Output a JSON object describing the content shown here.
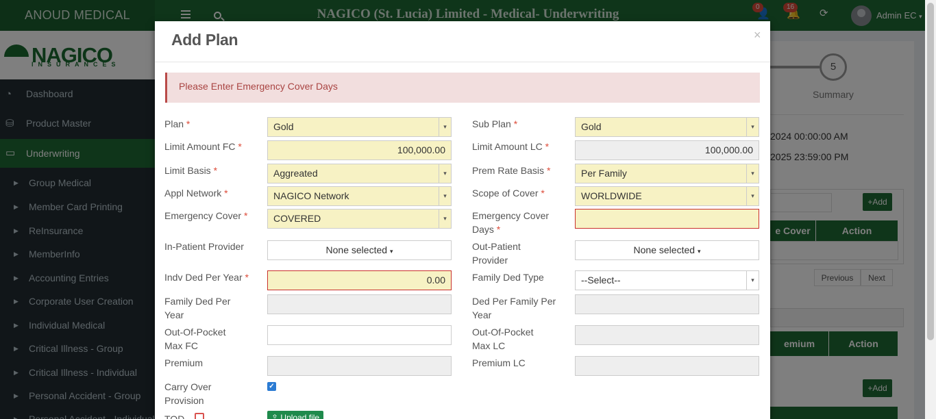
{
  "topbar": {
    "brand": "ANOUD MEDICAL",
    "title": "NAGICO (St. Lucia) Limited - Medical- Underwriting",
    "user_badge": "0",
    "notif_badge": "16",
    "user_name": "Admin EC"
  },
  "logo": {
    "text": "NAGICO",
    "sub": "INSURANCES"
  },
  "sidebar": {
    "items": [
      {
        "label": "Dashboard"
      },
      {
        "label": "Product Master"
      },
      {
        "label": "Underwriting"
      }
    ],
    "subitems": [
      "Group Medical",
      "Member Card Printing",
      "ReInsurance",
      "MemberInfo",
      "Accounting Entries",
      "Corporate User Creation",
      "Individual Medical",
      "Critical Illness - Group",
      "Critical Illness - Individual",
      "Personal Accident - Group",
      "Personal Accident - Individual"
    ]
  },
  "background": {
    "step_number": "5",
    "step_label": "Summary",
    "date1": "2024 00:00:00 AM",
    "date2": "2025 23:59:00 PM",
    "add_label": "Add",
    "col_cover": "e Cover",
    "col_action": "Action",
    "prev_label": "Previous",
    "next_label": "Next",
    "col_premium": "emium",
    "col_action2": "Action",
    "add_label2": "Add"
  },
  "modal": {
    "title": "Add Plan",
    "close": "×",
    "alert": "Please Enter Emergency Cover Days",
    "fields": {
      "plan": {
        "label": "Plan",
        "value": "Gold"
      },
      "sub_plan": {
        "label": "Sub Plan",
        "value": "Gold"
      },
      "limit_fc": {
        "label": "Limit Amount FC",
        "value": "100,000.00"
      },
      "limit_lc": {
        "label": "Limit Amount LC",
        "value": "100,000.00"
      },
      "limit_basis": {
        "label": "Limit Basis",
        "value": "Aggreated"
      },
      "prem_rate_basis": {
        "label": "Prem Rate Basis",
        "value": "Per Family"
      },
      "appl_network": {
        "label": "Appl Network",
        "value": "NAGICO Network"
      },
      "scope_cover": {
        "label": "Scope of Cover",
        "value": "WORLDWIDE"
      },
      "emergency_cover": {
        "label": "Emergency Cover",
        "value": "COVERED"
      },
      "emergency_days": {
        "label1": "Emergency Cover",
        "label2": "Days",
        "value": ""
      },
      "inpatient": {
        "label": "In-Patient Provider",
        "value": "None selected"
      },
      "outpatient": {
        "label1": "Out-Patient",
        "label2": "Provider",
        "value": "None selected"
      },
      "indv_ded": {
        "label": "Indv Ded Per Year",
        "value": "0.00"
      },
      "family_ded_type": {
        "label": "Family Ded Type",
        "value": "--Select--"
      },
      "family_ded_year": {
        "label1": "Family Ded Per",
        "label2": "Year",
        "value": ""
      },
      "ded_per_family": {
        "label1": "Ded Per Family Per",
        "label2": "Year",
        "value": ""
      },
      "oop_fc": {
        "label1": "Out-Of-Pocket",
        "label2": "Max FC",
        "value": ""
      },
      "oop_lc": {
        "label1": "Out-Of-Pocket",
        "label2": "Max LC",
        "value": ""
      },
      "premium": {
        "label": "Premium",
        "value": ""
      },
      "premium_lc": {
        "label": "Premium LC",
        "value": ""
      },
      "carry_over": {
        "label1": "Carry Over",
        "label2": "Provision",
        "checked": true
      }
    },
    "tod_label": "TOD",
    "upload_label": "Upload file"
  }
}
